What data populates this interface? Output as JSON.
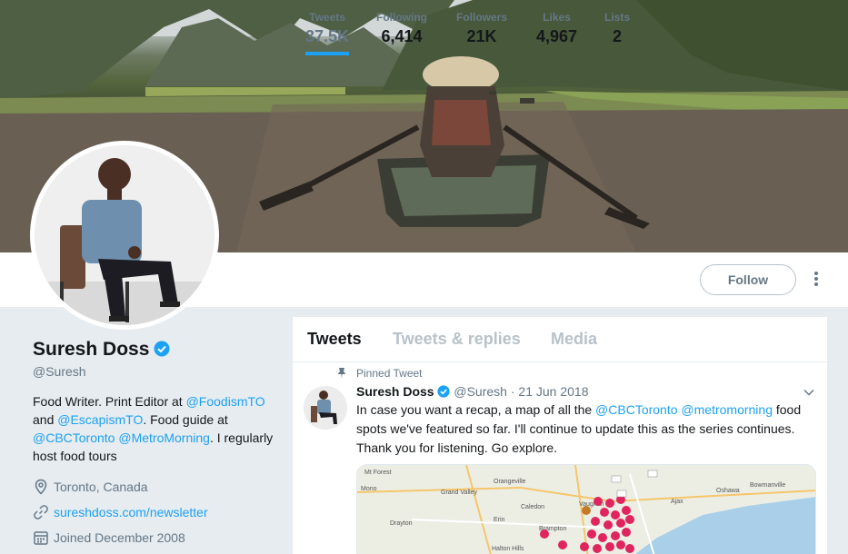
{
  "profile": {
    "name": "Suresh Doss",
    "handle": "@Suresh",
    "bio": {
      "t1": "Food Writer. Print Editor at ",
      "l1": "@FoodismTO",
      "t2": "and ",
      "l2": "@EscapismTO",
      "t3": ". Food guide at ",
      "l3": "@CBCToronto",
      "l4": "@MetroMorning",
      "t4": ". I regularly host food tours"
    },
    "location": "Toronto, Canada",
    "website": "sureshdoss.com/newsletter",
    "joined": "Joined December 2008"
  },
  "stats": [
    {
      "label": "Tweets",
      "value": "37.5K"
    },
    {
      "label": "Following",
      "value": "6,414"
    },
    {
      "label": "Followers",
      "value": "21K"
    },
    {
      "label": "Likes",
      "value": "4,967"
    },
    {
      "label": "Lists",
      "value": "2"
    }
  ],
  "follow_label": "Follow",
  "tabs": [
    "Tweets",
    "Tweets & replies",
    "Media"
  ],
  "pinned_label": "Pinned Tweet",
  "tweet": {
    "name": "Suresh Doss",
    "handle": "@Suresh",
    "sep": " · ",
    "date": "21 Jun 2018",
    "t1": "In case you want a recap, a map of all the ",
    "l1": "@CBCToronto",
    "l2": "@metromorning",
    "t2": " food spots we've featured so far. I'll continue to update this as the series continues. Thank you for listening. Go explore."
  },
  "map_labels": [
    "Mt Forest",
    "Mono",
    "Grand Valley",
    "Orangeville",
    "Caledon",
    "Vaughan",
    "Ajax",
    "Oshawa",
    "Bowmanville",
    "Brampton",
    "Erin",
    "Drayton",
    "Halton Hills"
  ],
  "colors": {
    "accent": "#1da1f2",
    "muted": "#657786",
    "pin": "#e0245e"
  }
}
